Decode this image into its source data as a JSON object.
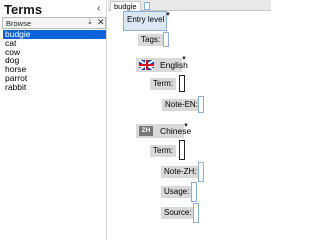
{
  "left": {
    "title": "Terms",
    "collapse_glyph": "‹",
    "browse_label": "Browse",
    "pin_glyph": "⇣",
    "close_glyph": "✕",
    "words": [
      "budgie",
      "cat",
      "cow",
      "dog",
      "horse",
      "parrot",
      "rabbit"
    ],
    "selected_index": 0
  },
  "right": {
    "tab_label": "budgie",
    "entry_level": "Entry level",
    "tags_label": "Tags:",
    "english": {
      "name": "English",
      "term_label": "Term:",
      "note_label": "Note-EN:"
    },
    "chinese": {
      "badge": "ZH",
      "name": "Chinese",
      "term_label": "Term:",
      "note_label": "Note-ZH:",
      "usage_label": "Usage:",
      "source_label": "Source:"
    }
  },
  "colors": {
    "selection": "#0a64d8",
    "field_border": "#8ab0d6",
    "label_bg": "#d9d9d9",
    "entry_level_bg": "#dbe7f5"
  },
  "icons": {
    "collapse": "chevron-left-icon",
    "pin": "pin-icon",
    "close": "close-icon",
    "dropdown": "triangle-down-icon",
    "english_flag": "uk-flag-icon"
  }
}
